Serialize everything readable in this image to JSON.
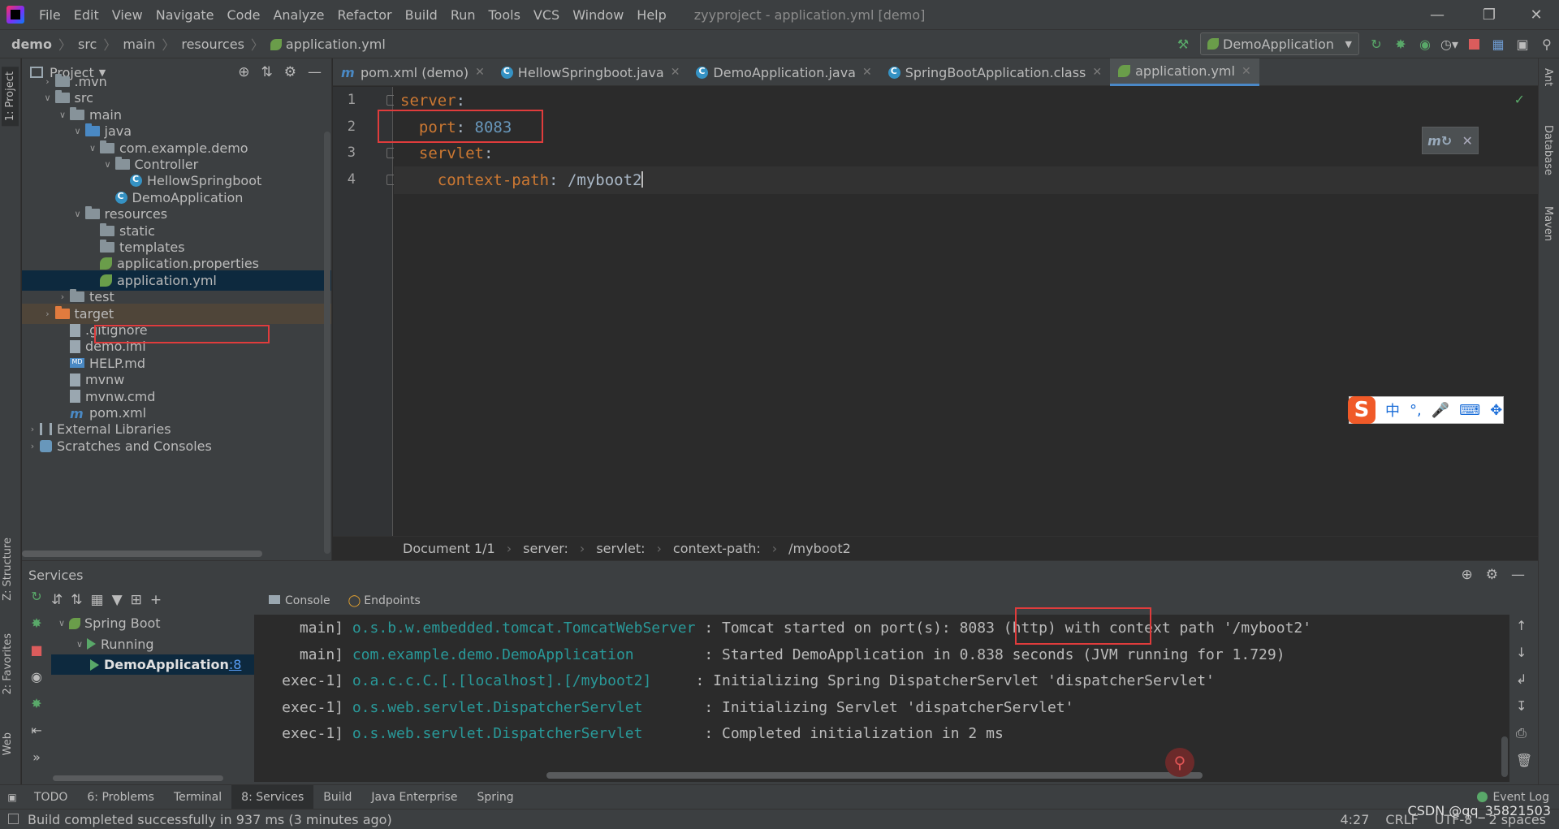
{
  "menu": {
    "items": [
      "File",
      "Edit",
      "View",
      "Navigate",
      "Code",
      "Analyze",
      "Refactor",
      "Build",
      "Run",
      "Tools",
      "VCS",
      "Window",
      "Help"
    ],
    "window_title": "zyyproject - application.yml [demo]"
  },
  "nav": {
    "crumbs": [
      "demo",
      "src",
      "main",
      "resources",
      "application.yml"
    ],
    "run_config": "DemoApplication"
  },
  "stripes": {
    "left": [
      "1: Project",
      "Z: Structure",
      "2: Favorites",
      "Web"
    ],
    "right": [
      "Ant",
      "Database",
      "Maven"
    ]
  },
  "project": {
    "title": "Project",
    "tree": [
      {
        "label": ".mvn",
        "depth": 1,
        "arrow": "closed",
        "icon": "folder"
      },
      {
        "label": "src",
        "depth": 1,
        "arrow": "open",
        "icon": "folder"
      },
      {
        "label": "main",
        "depth": 2,
        "arrow": "open",
        "icon": "folder"
      },
      {
        "label": "java",
        "depth": 3,
        "arrow": "open",
        "icon": "folder src"
      },
      {
        "label": "com.example.demo",
        "depth": 4,
        "arrow": "open",
        "icon": "folder"
      },
      {
        "label": "Controller",
        "depth": 5,
        "arrow": "open",
        "icon": "folder"
      },
      {
        "label": "HellowSpringboot",
        "depth": 6,
        "arrow": "none",
        "icon": "cls"
      },
      {
        "label": "DemoApplication",
        "depth": 5,
        "arrow": "none",
        "icon": "cls"
      },
      {
        "label": "resources",
        "depth": 3,
        "arrow": "open",
        "icon": "folder"
      },
      {
        "label": "static",
        "depth": 4,
        "arrow": "none",
        "icon": "folder"
      },
      {
        "label": "templates",
        "depth": 4,
        "arrow": "none",
        "icon": "folder"
      },
      {
        "label": "application.properties",
        "depth": 4,
        "arrow": "none",
        "icon": "spring"
      },
      {
        "label": "application.yml",
        "depth": 4,
        "arrow": "none",
        "icon": "spring",
        "selected": true
      },
      {
        "label": "test",
        "depth": 2,
        "arrow": "closed",
        "icon": "folder"
      },
      {
        "label": "target",
        "depth": 1,
        "arrow": "closed",
        "icon": "folder excl",
        "excluded": true
      },
      {
        "label": ".gitignore",
        "depth": 2,
        "arrow": "none",
        "icon": "file"
      },
      {
        "label": "demo.iml",
        "depth": 2,
        "arrow": "none",
        "icon": "file"
      },
      {
        "label": "HELP.md",
        "depth": 2,
        "arrow": "none",
        "icon": "md"
      },
      {
        "label": "mvnw",
        "depth": 2,
        "arrow": "none",
        "icon": "file"
      },
      {
        "label": "mvnw.cmd",
        "depth": 2,
        "arrow": "none",
        "icon": "file"
      },
      {
        "label": "pom.xml",
        "depth": 2,
        "arrow": "none",
        "icon": "m"
      },
      {
        "label": "External Libraries",
        "depth": 0,
        "arrow": "closed",
        "icon": "lib"
      },
      {
        "label": "Scratches and Consoles",
        "depth": 0,
        "arrow": "closed",
        "icon": "scratch"
      }
    ]
  },
  "editor": {
    "tabs": [
      {
        "label": "pom.xml (demo)",
        "icon": "m"
      },
      {
        "label": "HellowSpringboot.java",
        "icon": "cls"
      },
      {
        "label": "DemoApplication.java",
        "icon": "cls"
      },
      {
        "label": "SpringBootApplication.class",
        "icon": "cls"
      },
      {
        "label": "application.yml",
        "icon": "spring",
        "active": true
      }
    ],
    "lines": [
      {
        "num": "1",
        "indent": "",
        "key": "server",
        "colon": ":",
        "value": ""
      },
      {
        "num": "2",
        "indent": "  ",
        "key": "port",
        "colon": ": ",
        "value": "8083"
      },
      {
        "num": "3",
        "indent": "  ",
        "key": "servlet",
        "colon": ":",
        "value": ""
      },
      {
        "num": "4",
        "indent": "    ",
        "key": "context-path",
        "colon": ": ",
        "value": "/myboot2"
      }
    ],
    "breadcrumb": [
      "Document 1/1",
      "server:",
      "servlet:",
      "context-path:",
      "/myboot2"
    ]
  },
  "services": {
    "title": "Services",
    "console_tabs": [
      "Console",
      "Endpoints"
    ],
    "tree": [
      {
        "label": "Spring Boot",
        "depth": 0
      },
      {
        "label": "Running",
        "depth": 1
      },
      {
        "label": "DemoApplication",
        "suffix": ":8",
        "depth": 2,
        "selected": true
      }
    ],
    "log": [
      {
        "thread": "main]",
        "logger": "o.s.b.w.embedded.tomcat.TomcatWebServer ",
        "msg": ": Tomcat started on port(s): 8083 (http) with context path '/myboot2'"
      },
      {
        "thread": "main]",
        "logger": "com.example.demo.DemoApplication        ",
        "msg": ": Started DemoApplication in 0.838 seconds (JVM running for 1.729)"
      },
      {
        "thread": "exec-1]",
        "logger": "o.a.c.c.C.[.[localhost].[/myboot2]     ",
        "msg": ": Initializing Spring DispatcherServlet 'dispatcherServlet'"
      },
      {
        "thread": "exec-1]",
        "logger": "o.s.web.servlet.DispatcherServlet       ",
        "msg": ": Initializing Servlet 'dispatcherServlet'"
      },
      {
        "thread": "exec-1]",
        "logger": "o.s.web.servlet.DispatcherServlet       ",
        "msg": ": Completed initialization in 2 ms"
      }
    ]
  },
  "tool_tabs": [
    "TODO",
    "6: Problems",
    "Terminal",
    "8: Services",
    "Build",
    "Java Enterprise",
    "Spring"
  ],
  "tool_tab_active": "8: Services",
  "event_log": "Event Log",
  "status": {
    "message": "Build completed successfully in 937 ms (3 minutes ago)",
    "position": "4:27",
    "line_sep": "CRLF",
    "encoding": "UTF-8",
    "indent": "2 spaces",
    "watermark": "CSDN @qq_35821503"
  },
  "ime": {
    "chars": [
      "中",
      "°,",
      "🎤",
      "⌨",
      "✥"
    ]
  }
}
